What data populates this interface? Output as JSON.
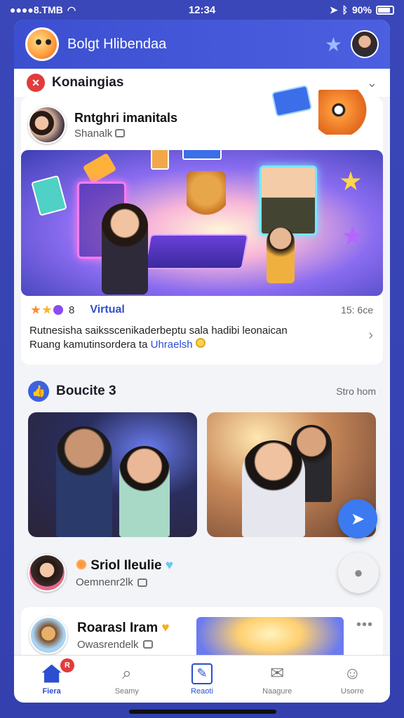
{
  "status_bar": {
    "carrier": "●●●●8.TMB",
    "time": "12:34",
    "battery": "90%"
  },
  "app": {
    "title": "Bolgt Hlibendaa"
  },
  "section": {
    "title": "Konaingias"
  },
  "post1": {
    "author": "Rntghri imanitals",
    "handle": "Shanalk",
    "badge_count": "8",
    "tag": "Virtual",
    "time": "15: 6ce",
    "text_line1": "Rutnesisha saiksscenikaderbeptu sala hadibi leonaican",
    "text_line2": "Ruang kamutinsordera ta",
    "text_link": "Uhraelsh"
  },
  "section2": {
    "title": "Boucite 3",
    "action": "Stro hom"
  },
  "story": {
    "title": "Sriol Ileulie",
    "sub": "Oemnenr2lk"
  },
  "post3": {
    "title": "Roarasl Iram",
    "sub": "Owasrendelk"
  },
  "tabs": [
    {
      "label": "Fiera",
      "badge": "R"
    },
    {
      "label": "Seamy"
    },
    {
      "label": "Reaoti"
    },
    {
      "label": "Naagure"
    },
    {
      "label": "Usorre"
    }
  ],
  "colors": {
    "brand": "#3b4fd0",
    "accent": "#2b4fd0",
    "alert": "#e23b3b"
  }
}
